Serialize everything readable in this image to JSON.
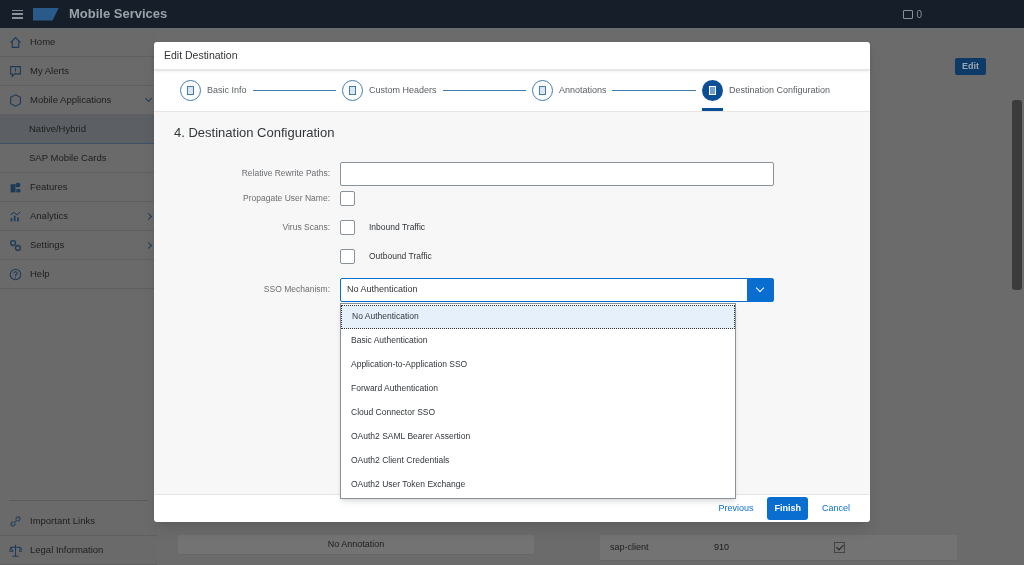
{
  "shell": {
    "title": "Mobile Services",
    "notifications": "0"
  },
  "sidebar": {
    "items": [
      {
        "label": "Home",
        "kind": "item",
        "selected": false
      },
      {
        "label": "My Alerts",
        "kind": "item",
        "selected": false
      },
      {
        "label": "Mobile Applications",
        "kind": "group",
        "expanded": true,
        "selected": false
      },
      {
        "label": "Native/Hybrid",
        "kind": "subitem",
        "selected": true
      },
      {
        "label": "SAP Mobile Cards",
        "kind": "subitem",
        "selected": false
      },
      {
        "label": "Features",
        "kind": "item",
        "selected": false
      },
      {
        "label": "Analytics",
        "kind": "group",
        "expanded": false,
        "selected": false
      },
      {
        "label": "Settings",
        "kind": "group",
        "expanded": false,
        "selected": false
      },
      {
        "label": "Help",
        "kind": "item",
        "selected": false
      }
    ],
    "footer_items": [
      {
        "label": "Important Links"
      },
      {
        "label": "Legal Information"
      }
    ]
  },
  "background": {
    "edit_button": "Edit",
    "annotation_cell": "No Annotation",
    "header_row": {
      "name": "sap-client",
      "value": "910",
      "override_client": true
    }
  },
  "dialog": {
    "title": "Edit Destination",
    "steps": [
      {
        "label": "Basic Info",
        "selected": false
      },
      {
        "label": "Custom Headers",
        "selected": false
      },
      {
        "label": "Annotations",
        "selected": false
      },
      {
        "label": "Destination Configuration",
        "selected": true
      }
    ],
    "heading": "4. Destination Configuration",
    "fields": [
      {
        "kind": "text",
        "label": "Relative Rewrite Paths:"
      },
      {
        "kind": "checkbox",
        "label": "Propagate User Name:",
        "checked": false
      },
      {
        "kind": "checkbox",
        "label": "Virus Scans:",
        "option": "Inbound Traffic",
        "checked": false
      },
      {
        "kind": "checkbox",
        "option": "Outbound Traffic",
        "checked": false
      },
      {
        "kind": "select",
        "label": "SSO Mechanism:",
        "value": "No Authentication",
        "expanded": true,
        "options": [
          {
            "label": "No Authentication",
            "selected": true
          },
          {
            "label": "Basic Authentication",
            "selected": false
          },
          {
            "label": "Application-to-Application SSO",
            "selected": false
          },
          {
            "label": "Forward Authentication",
            "selected": false
          },
          {
            "label": "Cloud Connector SSO",
            "selected": false
          },
          {
            "label": "OAuth2 SAML Bearer Assertion",
            "selected": false
          },
          {
            "label": "OAuth2 Client Credentials",
            "selected": false
          },
          {
            "label": "OAuth2 User Token Exchange",
            "selected": false
          }
        ]
      }
    ],
    "buttons": [
      {
        "label": "Previous",
        "kind": "link"
      },
      {
        "label": "Finish",
        "kind": "primary"
      },
      {
        "label": "Cancel",
        "kind": "link"
      }
    ]
  }
}
